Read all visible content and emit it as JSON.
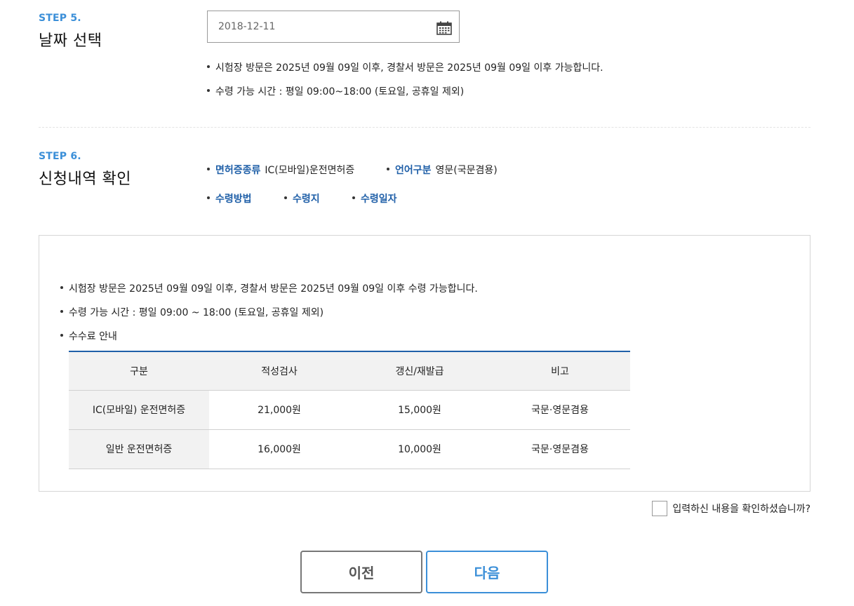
{
  "step5": {
    "label": "STEP 5.",
    "title": "날짜 선택",
    "date_value": "2018-12-11",
    "notes": [
      "시험장 방문은 2025년 09월 09일 이후, 경찰서 방문은 2025년 09월 09일 이후 가능합니다.",
      "수령 가능 시간 : 평일 09:00~18:00 (토요일, 공휴일 제외)"
    ]
  },
  "step6": {
    "label": "STEP 6.",
    "title": "신청내역 확인",
    "summary": [
      {
        "key": "면허증종류",
        "value": "IC(모바일)운전면허증"
      },
      {
        "key": "언어구분",
        "value": "영문(국문겸용)"
      },
      {
        "key": "수령방법",
        "value": ""
      },
      {
        "key": "수령지",
        "value": ""
      },
      {
        "key": "수령일자",
        "value": ""
      }
    ]
  },
  "info": {
    "notes": [
      "시험장 방문은 2025년 09월 09일 이후, 경찰서 방문은 2025년 09월 09일 이후 수령 가능합니다.",
      "수령 가능 시간 : 평일 09:00 ~ 18:00 (토요일, 공휴일 제외)",
      "수수료 안내"
    ],
    "table": {
      "headers": [
        "구분",
        "적성검사",
        "갱신/재발급",
        "비고"
      ],
      "rows": [
        [
          "IC(모바일) 운전면허증",
          "21,000원",
          "15,000원",
          "국문·영문겸용"
        ],
        [
          "일반 운전면허증",
          "16,000원",
          "10,000원",
          "국문·영문겸용"
        ]
      ]
    }
  },
  "confirm": {
    "label": "입력하신 내용을 확인하셨습니까?"
  },
  "buttons": {
    "prev": "이전",
    "next": "다음"
  },
  "icons": {
    "date": "calendar-icon"
  },
  "colors": {
    "accent": "#3b8fd8",
    "key_text": "#1f5fa8"
  }
}
